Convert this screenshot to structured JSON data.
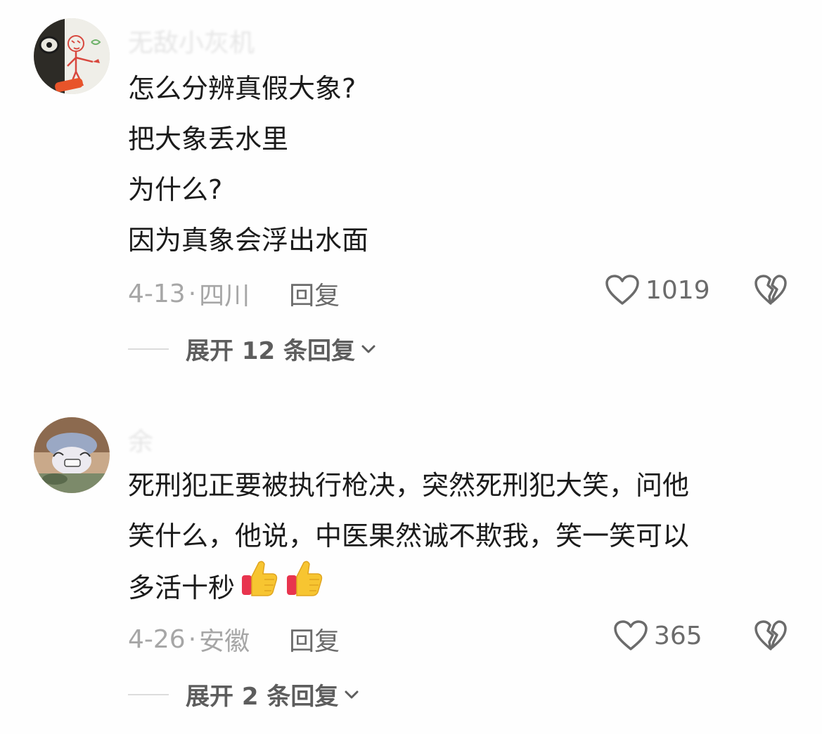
{
  "comments": [
    {
      "username": "无敌小灰机",
      "lines": [
        "怎么分辨真假大象?",
        "把大象丢水里",
        "为什么?",
        "因为真象会浮出水面"
      ],
      "date": "4-13",
      "location": "四川",
      "reply_label": "回复",
      "likes": "1019",
      "expand_label": "展开 12 条回复",
      "avatar_icon": "cartoon-drawing-avatar",
      "like_icon": "heart-outline-icon",
      "dislike_icon": "broken-heart-icon"
    },
    {
      "username": "余",
      "lines": [
        "死刑犯正要被执行枪决，突然死刑犯大笑，问他",
        "笑什么，他说，中医果然诚不欺我，笑一笑可以",
        "多活十秒"
      ],
      "emojis": [
        "thumbs-up-icon",
        "thumbs-up-icon"
      ],
      "date": "4-26",
      "location": "安徽",
      "reply_label": "回复",
      "likes": "365",
      "expand_label": "展开 2 条回复",
      "avatar_icon": "anime-character-avatar",
      "like_icon": "heart-outline-icon",
      "dislike_icon": "broken-heart-icon"
    }
  ],
  "separator": "·",
  "colors": {
    "background": "#fefefe",
    "text": "#1b1b1b",
    "meta": "#a6a6a6",
    "action": "#6b6b6b",
    "thumb_yellow": "#f7c531",
    "thumb_red": "#e8344e"
  }
}
